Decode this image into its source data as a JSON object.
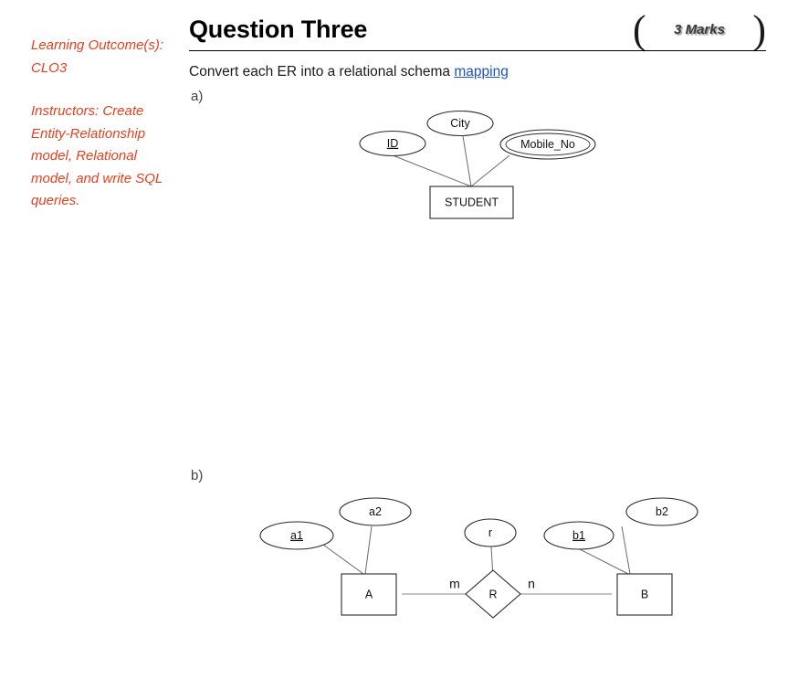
{
  "sidebar": {
    "blocks": [
      {
        "text": "Learning Outcome(s): CLO3"
      },
      {
        "text": "Instructors: Create Entity-Relationship model, Relational model, and write SQL queries."
      }
    ],
    "color": "#E8401E"
  },
  "header": {
    "title": "Question Three",
    "marks_label": "3 Marks",
    "bracket_left": "(",
    "bracket_right": ")"
  },
  "instruction": {
    "text_before": "Convert each ER into a relational schema ",
    "link_text": "mapping",
    "link_color": "#1b52c4"
  },
  "parts": {
    "a_label": "a)",
    "b_label": "b)"
  },
  "diagram_a": {
    "entity": "STUDENT",
    "attributes": [
      {
        "name": "ID",
        "kind": "key",
        "underlined": true
      },
      {
        "name": "City",
        "kind": "simple",
        "underlined": false
      },
      {
        "name": "Mobile_No",
        "kind": "multivalued",
        "underlined": false
      }
    ]
  },
  "diagram_b": {
    "entities": [
      {
        "name": "A"
      },
      {
        "name": "B"
      }
    ],
    "relationship": {
      "name": "R",
      "attribute": "r"
    },
    "cardinality": {
      "left": "m",
      "right": "n"
    },
    "attributes_a": [
      {
        "name": "a1",
        "kind": "key",
        "underlined": true
      },
      {
        "name": "a2",
        "kind": "simple",
        "underlined": false
      }
    ],
    "attributes_b": [
      {
        "name": "b1",
        "kind": "key",
        "underlined": true
      },
      {
        "name": "b2",
        "kind": "simple",
        "underlined": false
      }
    ]
  }
}
